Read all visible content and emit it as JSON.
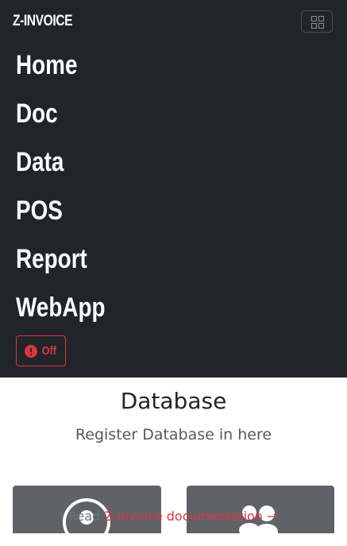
{
  "navbar": {
    "brand": "Z-INVOICE",
    "toggler_icon": "grid-icon",
    "items": [
      {
        "label": "Home"
      },
      {
        "label": "Doc"
      },
      {
        "label": "Data"
      },
      {
        "label": "POS"
      },
      {
        "label": "Report"
      },
      {
        "label": "WebApp"
      }
    ],
    "status_button": {
      "label": "Off",
      "icon": "exclamation-circle-icon",
      "color": "#dc3545"
    }
  },
  "hero": {
    "title": "Database",
    "subtitle": "Register Database in here"
  },
  "cards": [
    {
      "icon": "user-circle-icon"
    },
    {
      "icon": "users-icon"
    }
  ],
  "footer_link": {
    "prefix": "Read ",
    "link_text": "Z-invoice documentation →"
  },
  "colors": {
    "navbar_bg": "#212529",
    "accent": "#dc3545",
    "card_bg": "#5f6368"
  }
}
